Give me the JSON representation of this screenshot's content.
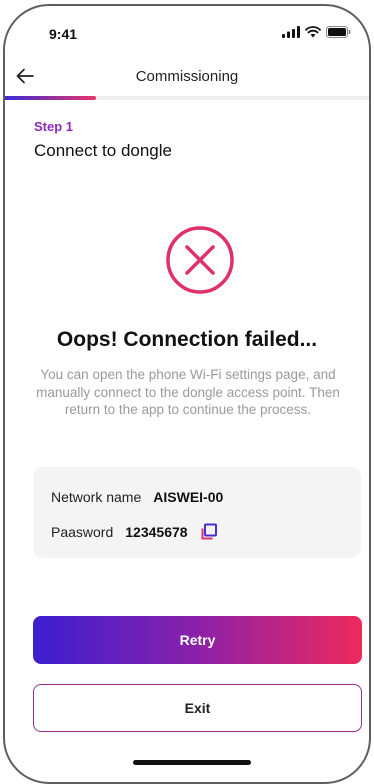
{
  "status_bar": {
    "time": "9:41",
    "icons": [
      "signal-icon",
      "wifi-icon",
      "battery-icon"
    ]
  },
  "nav": {
    "title": "Commissioning",
    "back_icon": "arrow-left-icon"
  },
  "progress": {
    "value": 0.25,
    "fill_color": "#e8346a"
  },
  "step": {
    "label": "Step 1",
    "title": "Connect to dongle"
  },
  "result": {
    "icon": "error-circle-x-icon",
    "icon_color": "#e0306a",
    "heading": "Oops! Connection failed...",
    "description": "You can open the phone Wi-Fi settings page, and manually connect to the dongle access point. Then return to the app to continue the process."
  },
  "network_info": {
    "network_label": "Network name",
    "network_value": "AISWEI-00",
    "password_label": "Paasword",
    "password_value": "12345678",
    "copy_icon": "copy-icon",
    "copy_icon_color": "#4a2bd6"
  },
  "actions": {
    "retry_label": "Retry",
    "exit_label": "Exit"
  },
  "colors": {
    "accent_purple": "#8d2ab8",
    "gradient_start": "#3a1fd1",
    "gradient_end": "#ee2a5b"
  }
}
